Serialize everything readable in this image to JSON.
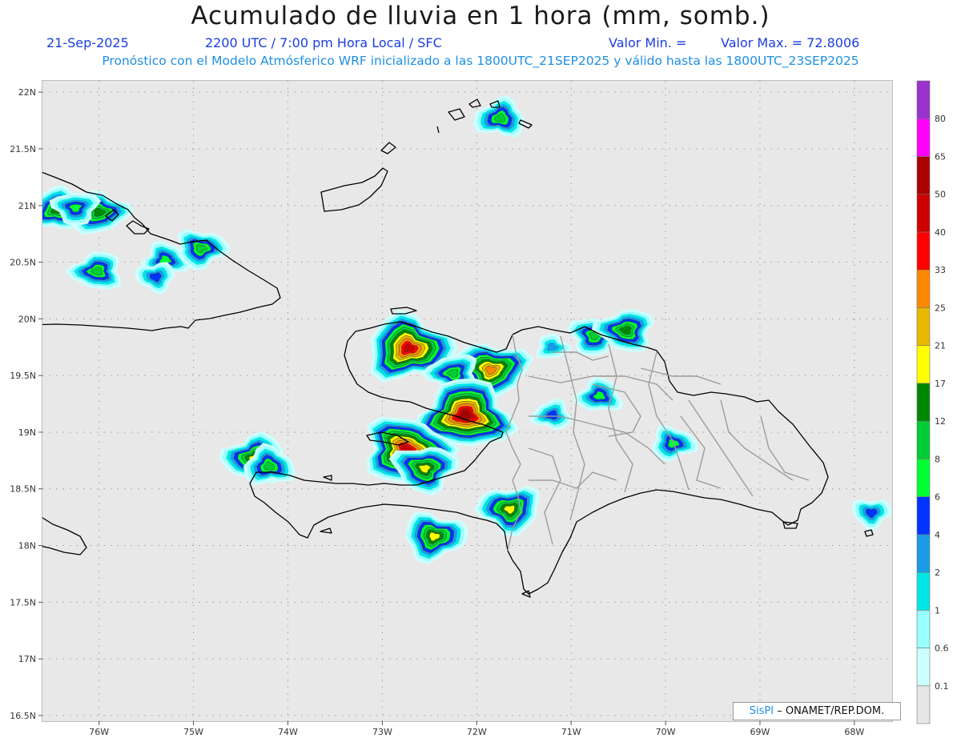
{
  "header": {
    "title": "Acumulado de lluvia en 1 hora (mm, somb.)",
    "date": "21-Sep-2025",
    "time_label": "2200 UTC / 7:00 pm Hora Local / SFC",
    "min_label": "Valor Min. =",
    "max_label": "Valor Max. = 72.8006",
    "forecast_note": "Pronóstico con el Modelo Atmósferico WRF inicializado a las 1800UTC_21SEP2025 y válido hasta las  1800UTC_23SEP2025"
  },
  "axes": {
    "lat_labels": [
      "22N",
      "21.5N",
      "21N",
      "20.5N",
      "20N",
      "19.5N",
      "19N",
      "18.5N",
      "18N",
      "17.5N",
      "17N",
      "16.5N"
    ],
    "lon_labels": [
      "76W",
      "75W",
      "74W",
      "73W",
      "72W",
      "71W",
      "70W",
      "69W",
      "68W"
    ]
  },
  "map": {
    "extent": {
      "lon_min": -76.6,
      "lon_max": -67.6,
      "lat_min": 16.45,
      "lat_max": 22.1
    },
    "background": "#e8e8e8",
    "rain_cells": [
      {
        "name": "cuba-east-1",
        "lon": -76.45,
        "lat": 20.96,
        "peak": 12
      },
      {
        "name": "cuba-east-2",
        "lon": -76.0,
        "lat": 20.94,
        "peak": 12
      },
      {
        "name": "cuba-east-3",
        "lon": -76.25,
        "lat": 20.98,
        "peak": 6
      },
      {
        "name": "cuba-east-4",
        "lon": -76.02,
        "lat": 20.42,
        "peak": 8
      },
      {
        "name": "cuba-east-5",
        "lon": -75.3,
        "lat": 20.52,
        "peak": 6
      },
      {
        "name": "cuba-east-6",
        "lon": -74.92,
        "lat": 20.62,
        "peak": 8
      },
      {
        "name": "cuba-east-7",
        "lon": -75.4,
        "lat": 20.37,
        "peak": 4
      },
      {
        "name": "turks-caicos",
        "lon": -71.75,
        "lat": 21.77,
        "peak": 8
      },
      {
        "name": "nw-haiti-peninsula",
        "lon": -72.72,
        "lat": 19.74,
        "peak": 40
      },
      {
        "name": "north-haiti-plain",
        "lon": -71.85,
        "lat": 19.55,
        "peak": 25
      },
      {
        "name": "north-haiti-2",
        "lon": -72.25,
        "lat": 19.52,
        "peak": 8
      },
      {
        "name": "central-plateau",
        "lon": -72.12,
        "lat": 19.15,
        "peak": 50
      },
      {
        "name": "artibonite-west",
        "lon": -72.75,
        "lat": 18.85,
        "peak": 40
      },
      {
        "name": "gonave-east",
        "lon": -72.55,
        "lat": 18.68,
        "peak": 17
      },
      {
        "name": "haiti-south-peninsula-west",
        "lon": -74.35,
        "lat": 18.77,
        "peak": 17
      },
      {
        "name": "haiti-south-peninsula-2",
        "lon": -74.2,
        "lat": 18.7,
        "peak": 8
      },
      {
        "name": "haiti-south-coast",
        "lon": -72.45,
        "lat": 18.08,
        "peak": 17
      },
      {
        "name": "lake-enriquillo",
        "lon": -71.65,
        "lat": 18.32,
        "peak": 17
      },
      {
        "name": "cibao-valley",
        "lon": -71.2,
        "lat": 19.15,
        "peak": 4
      },
      {
        "name": "monte-cristi",
        "lon": -71.2,
        "lat": 19.75,
        "peak": 2
      },
      {
        "name": "puerto-plata-1",
        "lon": -70.75,
        "lat": 19.85,
        "peak": 8
      },
      {
        "name": "puerto-plata-2",
        "lon": -70.42,
        "lat": 19.9,
        "peak": 12
      },
      {
        "name": "cordillera-central",
        "lon": -70.7,
        "lat": 19.32,
        "peak": 6
      },
      {
        "name": "samana-west",
        "lon": -69.92,
        "lat": 18.9,
        "peak": 6
      },
      {
        "name": "east-mona",
        "lon": -67.82,
        "lat": 18.29,
        "peak": 4
      }
    ]
  },
  "colorbar": {
    "labels": [
      "0.1",
      "0.6",
      "1",
      "2",
      "4",
      "6",
      "8",
      "12",
      "17",
      "21",
      "25",
      "33",
      "40",
      "50",
      "65",
      "80"
    ],
    "colors": [
      "#e6e6e6",
      "#ccffff",
      "#99ffff",
      "#00e5e5",
      "#1a9be6",
      "#0033ff",
      "#00ff33",
      "#00cc33",
      "#008800",
      "#ffff00",
      "#e6b800",
      "#ff8800",
      "#ff0000",
      "#cc0000",
      "#aa0000",
      "#ff00ff",
      "#9933cc"
    ]
  },
  "credit": {
    "brand": "SisPI",
    "text": "ONAMET/REP.DOM."
  }
}
